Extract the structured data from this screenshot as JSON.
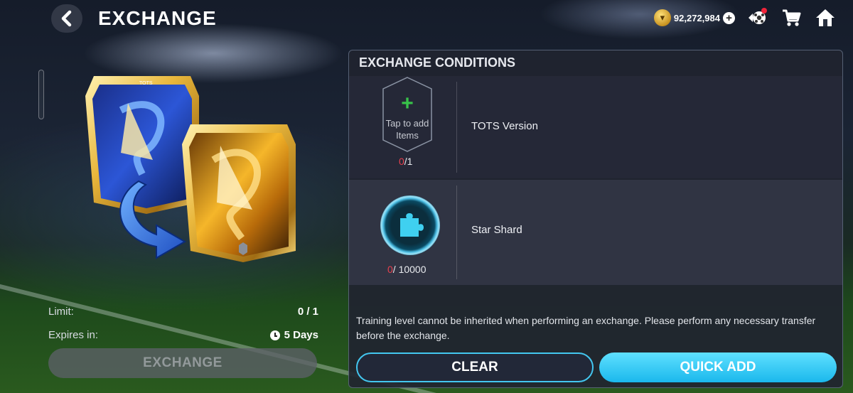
{
  "header": {
    "title": "EXCHANGE",
    "currency_amount": "92,272,984",
    "icons": [
      "back-arrow-icon",
      "coin-icon",
      "add-currency-icon",
      "notification-icon",
      "cart-icon",
      "home-icon"
    ]
  },
  "exchange_info": {
    "limit_label": "Limit:",
    "limit_value": "0 / 1",
    "expires_label": "Expires in:",
    "expires_value": "5 Days",
    "exchange_button": "EXCHANGE"
  },
  "conditions": {
    "title": "EXCHANGE CONDITIONS",
    "items": [
      {
        "slot_text": "Tap to add Items",
        "current": "0",
        "required": "/1",
        "label": "TOTS Version"
      },
      {
        "current": "0",
        "required": "/ 10000",
        "label": "Star Shard"
      }
    ],
    "note": "Training level cannot be inherited when performing an exchange. Please perform any necessary transfer before the exchange.",
    "clear_button": "CLEAR",
    "quick_add_button": "QUICK ADD"
  },
  "colors": {
    "accent": "#1bb8ec",
    "zero_count": "#e8404e",
    "add_green": "#38c24a"
  }
}
